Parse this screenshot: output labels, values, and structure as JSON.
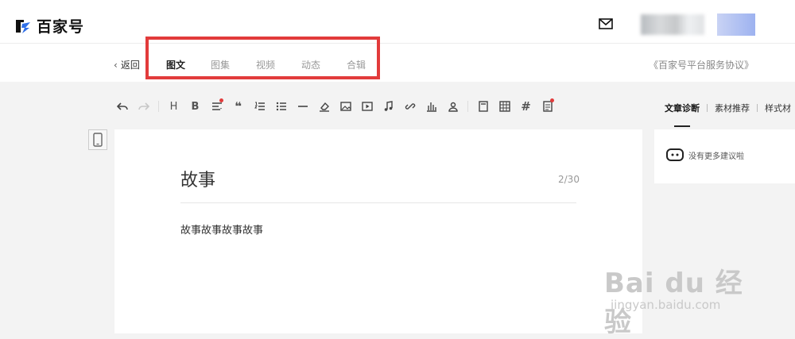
{
  "header": {
    "brand": "百家号",
    "mail_icon": "mail-icon"
  },
  "nav": {
    "back_label": "返回",
    "tabs": [
      {
        "label": "图文",
        "active": true
      },
      {
        "label": "图集",
        "active": false
      },
      {
        "label": "视频",
        "active": false
      },
      {
        "label": "动态",
        "active": false
      },
      {
        "label": "合辑",
        "active": false
      }
    ],
    "agreement": "《百家号平台服务协议》"
  },
  "toolbar": {
    "icons": [
      "undo-icon",
      "redo-icon",
      "heading-icon",
      "bold-icon",
      "align-icon",
      "quote-icon",
      "ordered-list-icon",
      "unordered-list-icon",
      "divider-icon",
      "eraser-icon",
      "image-icon",
      "video-icon",
      "audio-icon",
      "link-icon",
      "chart-icon",
      "user-icon",
      "card-icon",
      "table-icon",
      "hashtag-icon",
      "document-icon"
    ],
    "heading_label": "H",
    "bold_label": "B",
    "quote_label": "❝",
    "hashtag_label": "#"
  },
  "side": {
    "tabs": [
      {
        "label": "文章诊断",
        "active": true
      },
      {
        "label": "素材推荐",
        "active": false
      },
      {
        "label": "样式材",
        "active": false
      }
    ],
    "suggestion": "没有更多建议啦"
  },
  "editor": {
    "title": "故事",
    "title_count": "2/30",
    "body": "故事故事故事故事"
  },
  "watermark": {
    "main": "Bai du 经验",
    "sub": "jingyan.baidu.com"
  },
  "colors": {
    "highlight": "#e23b3b",
    "background": "#f3f3f3"
  }
}
